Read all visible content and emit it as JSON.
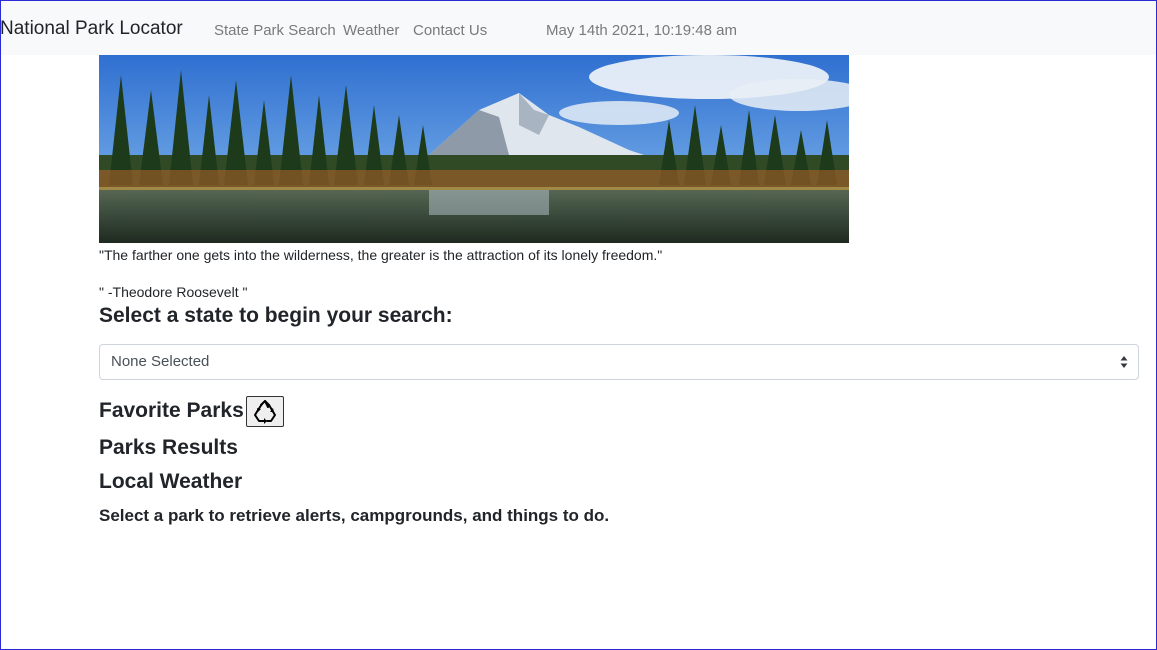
{
  "navbar": {
    "brand": "National Park Locator",
    "links": [
      "State Park Search",
      "Weather",
      "Contact Us"
    ],
    "datetime": "May 14th 2021, 10:19:48 am"
  },
  "hero": {
    "description": "Mountain lake landscape banner"
  },
  "quote": {
    "text": "\"The farther one gets into the wilderness, the greater is the attraction of its lonely freedom.\"",
    "author": "\" -Theodore Roosevelt \""
  },
  "search": {
    "heading": "Select a state to begin your search:",
    "selected": "None Selected"
  },
  "sections": {
    "favorites": "Favorite Parks",
    "results": "Parks Results",
    "weather": "Local Weather",
    "instruction": "Select a park to retrieve alerts, campgrounds, and things to do."
  },
  "icons": {
    "recycle": "recycle-icon",
    "select_caret": "sort-caret-icon"
  },
  "colors": {
    "navbar_bg": "#f8f9fa",
    "nav_link": "#7a7a7a",
    "text": "#212529",
    "frame": "#2b2bd6"
  }
}
